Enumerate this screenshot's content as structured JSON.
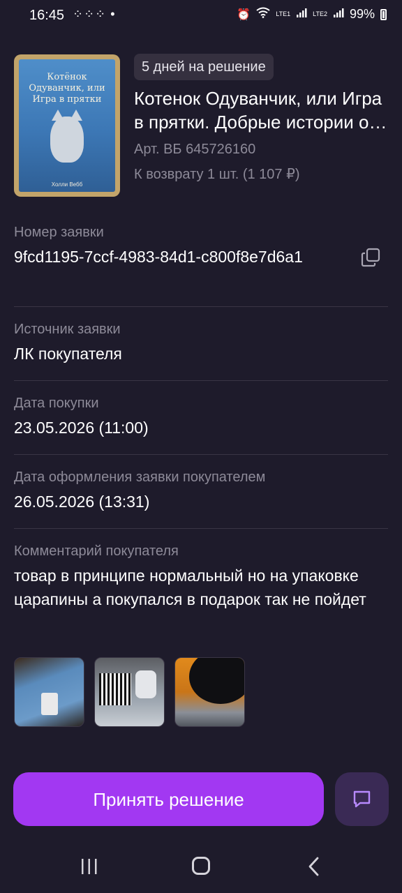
{
  "status_bar": {
    "time": "16:45",
    "notifications": "⁘⁘⁘ •",
    "sim1": "LTE1",
    "sim2": "LTE2",
    "battery": "99%"
  },
  "product": {
    "cover_title": "Котёнок Одуванчик, или Игра в прятки",
    "cover_author": "Холли Вебб",
    "badge": "5 дней на решение",
    "title": "Котенок Одуванчик, или Игра в прятки. Добрые истории о зверятах",
    "article": "Арт. ВБ 645726160",
    "return_info": "К возврату 1 шт. (1 107 ₽)"
  },
  "fields": {
    "request_number": {
      "label": "Номер заявки",
      "value": "9fcd1195-7ccf-4983-84d1-c800f8e7d6a1"
    },
    "request_source": {
      "label": "Источник заявки",
      "value": "ЛК покупателя"
    },
    "purchase_date": {
      "label": "Дата покупки",
      "value": "23.05.2026 (11:00)"
    },
    "request_date": {
      "label": "Дата оформления заявки покупателем",
      "value": "26.05.2026 (13:31)"
    },
    "comment": {
      "label": "Комментарий покупателя",
      "value": "товар в принципе нормальный но на упаковке царапины а покупался в подарок так не пойдет"
    }
  },
  "photos": [
    {
      "name": "customer-photo-1"
    },
    {
      "name": "customer-photo-2"
    },
    {
      "name": "customer-photo-3"
    }
  ],
  "actions": {
    "decision_button": "Принять решение",
    "chat_icon": "chat-icon"
  },
  "colors": {
    "background": "#1e1b2b",
    "accent": "#a238f2",
    "chat_button": "#3a2a55",
    "muted_text": "#8d8a98",
    "badge": "#35303f"
  }
}
